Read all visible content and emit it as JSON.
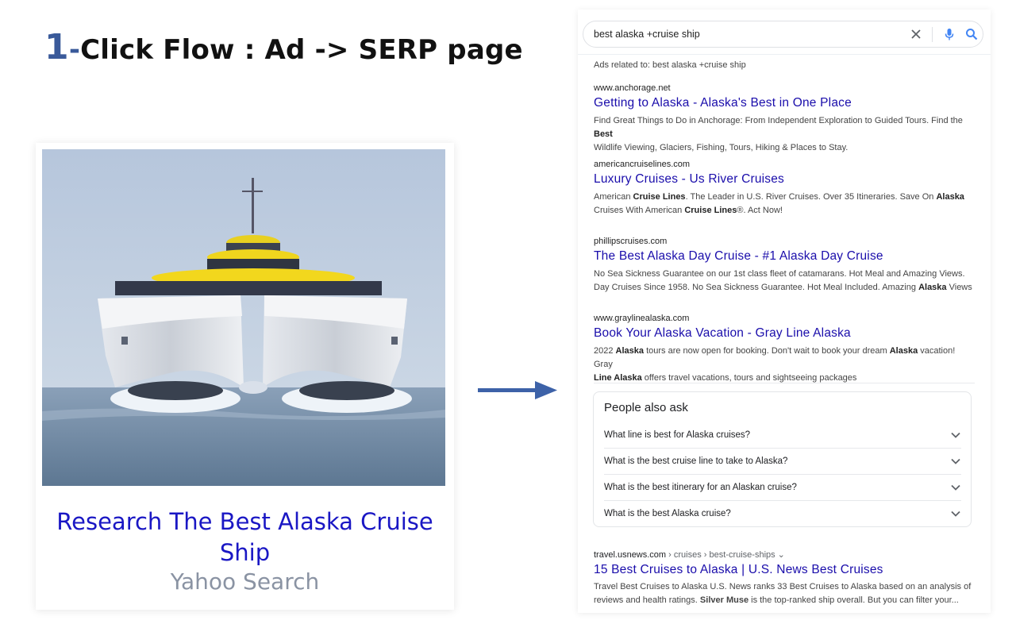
{
  "headline": {
    "number": "1",
    "dash": "-",
    "text": "Click Flow : Ad -> SERP page"
  },
  "ad": {
    "title": "Research The Best Alaska Cruise Ship",
    "source": "Yahoo Search",
    "image_subject": "catamaran cruise ship at sea"
  },
  "serp": {
    "search": {
      "query": "best alaska +cruise ship"
    },
    "ads_related": "Ads related to: best alaska +cruise ship",
    "ads": [
      {
        "url": "www.anchorage.net",
        "title": "Getting to Alaska - Alaska's Best in One Place",
        "desc_1": "Find Great Things to Do in Anchorage: From Independent Exploration to Guided Tours. Find the",
        "bold_1": "Best",
        "desc_2": "Wildlife Viewing, Glaciers, Fishing, Tours, Hiking & Places to Stay."
      },
      {
        "url": "americancruiselines.com",
        "title": "Luxury Cruises - Us River Cruises",
        "desc_1": "American",
        "bold_1": "Cruise Lines",
        "desc_2": ". The Leader in U.S. River Cruises. Over 35 Itineraries. Save On",
        "bold_2": "Alaska",
        "desc_3": "Cruises With American",
        "bold_3": "Cruise Lines",
        "desc_4": "®. Act Now!"
      },
      {
        "url": "phillipscruises.com",
        "title": "The Best Alaska Day Cruise - #1 Alaska Day Cruise",
        "desc_1": "No Sea Sickness Guarantee on our 1st class fleet of catamarans. Hot Meal and Amazing Views.",
        "desc_2": "Day Cruises Since 1958. No Sea Sickness Guarantee. Hot Meal Included. Amazing",
        "bold_1": "Alaska",
        "desc_3": "Views"
      },
      {
        "url": "www.graylinealaska.com",
        "title": "Book Your Alaska Vacation - Gray Line Alaska",
        "desc_1": "2022",
        "bold_1": "Alaska",
        "desc_2": "tours are now open for booking. Don't wait to book your dream",
        "bold_2": "Alaska",
        "desc_3": "vacation! Gray",
        "bold_3": "Line Alaska",
        "desc_4": "offers travel vacations, tours and sightseeing packages"
      }
    ],
    "people_also_ask": {
      "heading": "People also ask",
      "questions": [
        "What line is best for Alaska cruises?",
        "What is the best cruise line to take to Alaska?",
        "What is the best itinerary for an Alaskan cruise?",
        "What is the best Alaska cruise?"
      ]
    },
    "organic": {
      "domain": "travel.usnews.com",
      "path": " › cruises › best-cruise-ships ⌄",
      "title": "15 Best Cruises to Alaska | U.S. News Best Cruises",
      "desc_1": "Travel Best Cruises to Alaska U.S. News ranks 33 Best Cruises to Alaska based on an analysis of",
      "desc_2": "reviews and health ratings.",
      "bold_1": "Silver Muse",
      "desc_3": "is the top-ranked ship overall. But you can filter your..."
    }
  }
}
